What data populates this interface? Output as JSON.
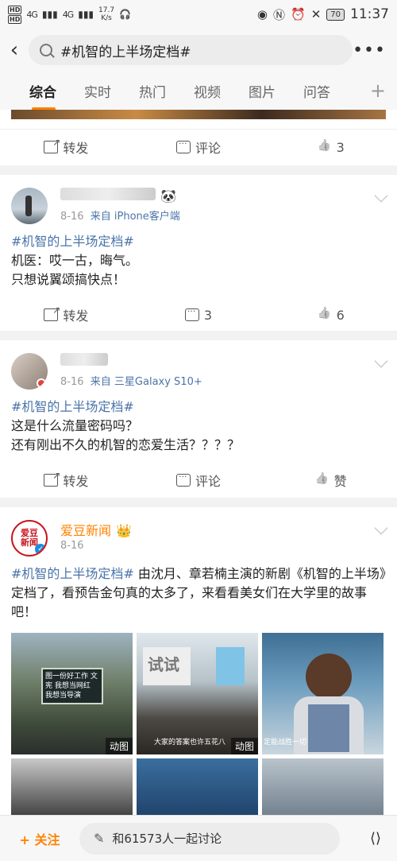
{
  "status": {
    "hd1": "HD",
    "hd2": "HD",
    "signal1": "4G",
    "signal2": "4G",
    "speed_value": "17.7",
    "speed_unit": "K/s",
    "battery": "70",
    "time": "11:37"
  },
  "search": {
    "query": "#机智的上半场定档#"
  },
  "tabs": [
    "综合",
    "实时",
    "热门",
    "视频",
    "图片",
    "问答"
  ],
  "post0": {
    "share": "转发",
    "comment": "评论",
    "likes": "3"
  },
  "post1": {
    "date": "8-16",
    "source": "来自 iPhone客户端",
    "hashtag": "#机智的上半场定档#",
    "line1": "机医：哎一古，晦气。",
    "line2": "只想说翼颂搞快点！",
    "share": "转发",
    "comments": "3",
    "likes": "6"
  },
  "post2": {
    "date": "8-16",
    "source": "来自 三星Galaxy S10+",
    "hashtag": "#机智的上半场定档#",
    "line1": "这是什么流量密码吗？",
    "line2": "还有刚出不久的机智的恋爱生活？？？？",
    "share": "转发",
    "comment": "评论",
    "like": "赞"
  },
  "post3": {
    "name": "爱豆新闻",
    "avatar_text": "爱豆新闻",
    "date": "8-16",
    "hashtag": "#机智的上半场定档#",
    "text": " 由沈月、章若楠主演的新剧《机智的上半场》定档了，看预告金句真的太多了，来看看美女们在大学里的故事吧！",
    "images": [
      {
        "caption": "图一份好工作 文宪 我想当网红 我想当导演",
        "badge": "动图"
      },
      {
        "caption": "试试",
        "subtitle": "大家的答案也许五花八",
        "badge": "动图"
      },
      {
        "caption": "定能战胜一切",
        "badge": ""
      }
    ]
  },
  "bottom": {
    "follow": "+ 关注",
    "discuss": "和61573人一起讨论"
  },
  "colors": {
    "accent": "#ff8200",
    "link": "#4a74a8"
  }
}
